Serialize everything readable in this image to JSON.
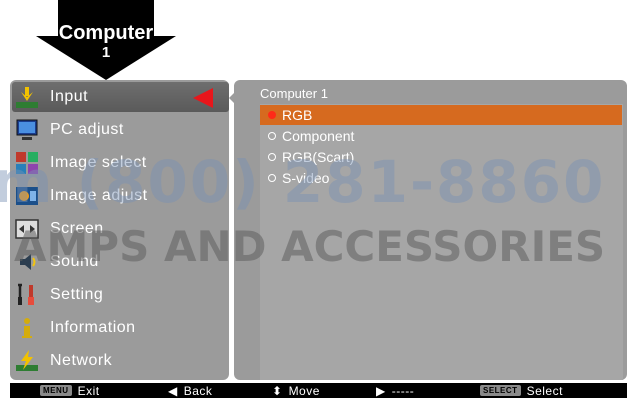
{
  "header": {
    "source_line1": "Computer",
    "source_line2": "1"
  },
  "menu": {
    "items": [
      {
        "label": "Input",
        "icon": "input-icon"
      },
      {
        "label": "PC adjust",
        "icon": "pc-adjust-icon"
      },
      {
        "label": "Image select",
        "icon": "image-select-icon"
      },
      {
        "label": "Image adjust",
        "icon": "image-adjust-icon"
      },
      {
        "label": "Screen",
        "icon": "screen-icon"
      },
      {
        "label": "Sound",
        "icon": "sound-icon"
      },
      {
        "label": "Setting",
        "icon": "setting-icon"
      },
      {
        "label": "Information",
        "icon": "information-icon"
      },
      {
        "label": "Network",
        "icon": "network-icon"
      }
    ],
    "selected_index": 0
  },
  "panel": {
    "title": "Computer 1",
    "options": [
      {
        "label": "RGB",
        "selected": true
      },
      {
        "label": "Component",
        "selected": false
      },
      {
        "label": "RGB(Scart)",
        "selected": false
      },
      {
        "label": "S-video",
        "selected": false
      }
    ]
  },
  "bottom": {
    "exit_key": "MENU",
    "exit": "Exit",
    "back": "Back",
    "move": "Move",
    "next": "-----",
    "select_key": "SELECT",
    "select": "Select"
  },
  "watermark": {
    "line1": "m (800) 281-8860",
    "line2": "AMPS AND ACCESSORIES"
  },
  "colors": {
    "panel": "#9b9b9b",
    "highlight": "#d66a1f",
    "arrow": "#e8161b"
  }
}
